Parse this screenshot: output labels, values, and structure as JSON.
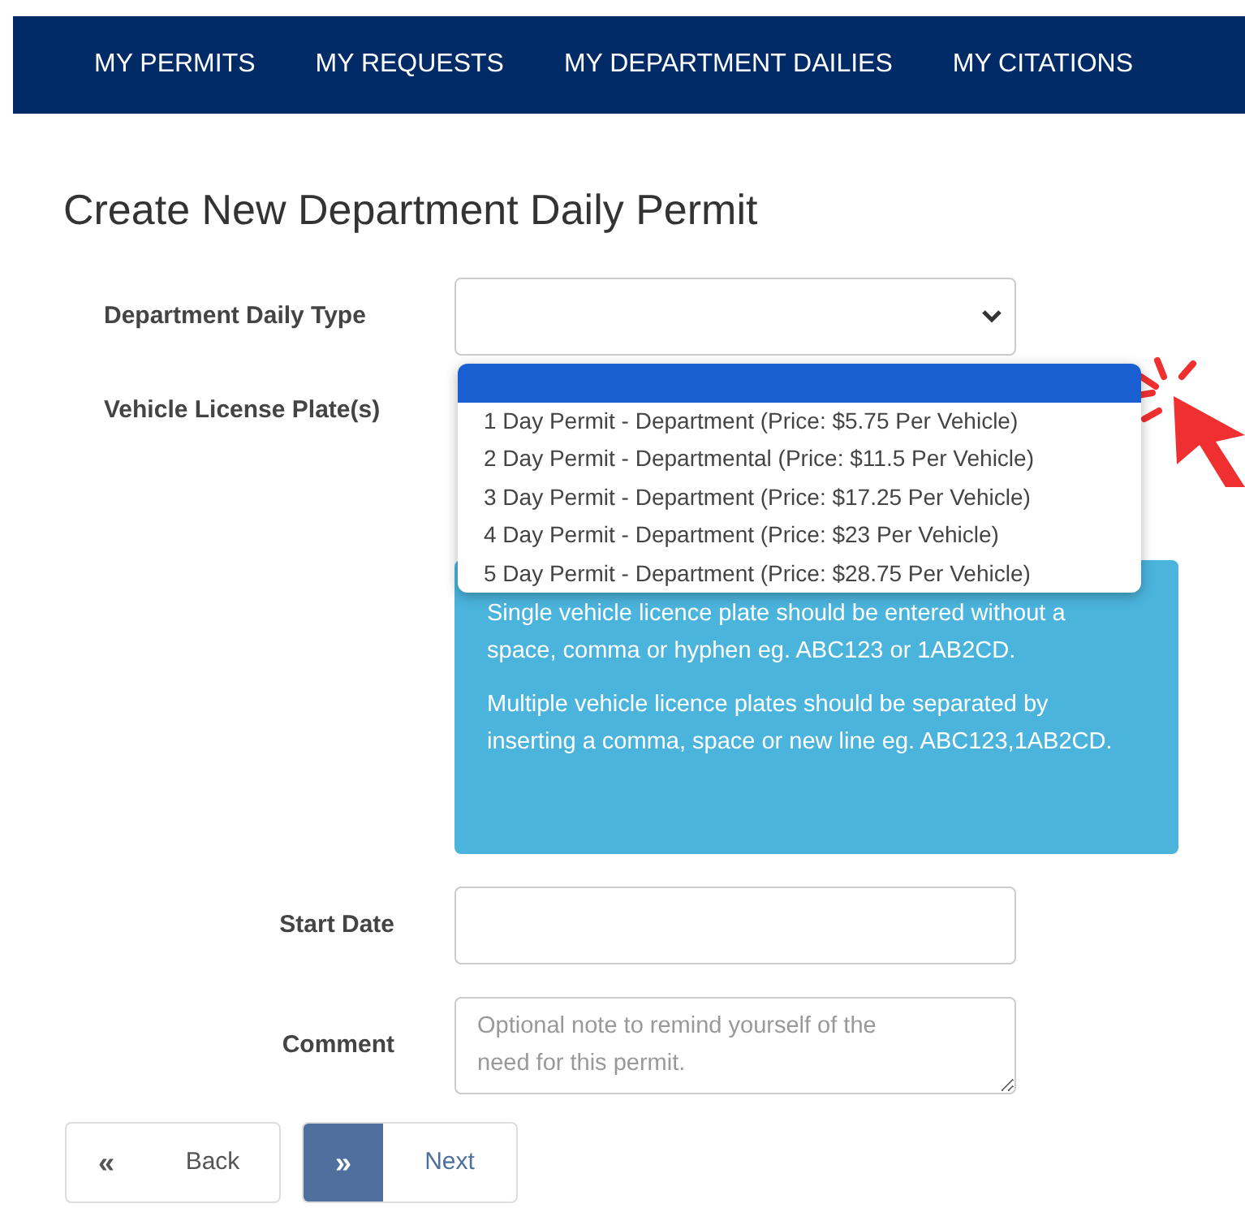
{
  "nav": [
    {
      "label": "MY PERMITS"
    },
    {
      "label": "MY REQUESTS"
    },
    {
      "label": "MY DEPARTMENT DAILIES"
    },
    {
      "label": "MY CITATIONS"
    }
  ],
  "title": "Create New Department Daily Permit",
  "type_field": {
    "label": "Department Daily Type",
    "expanded": true,
    "options": [
      {
        "selected": true
      },
      {
        "label": "1 Day Permit - Department (Price: $5.75 Per Vehicle)",
        "selected": false
      },
      {
        "label": "2 Day Permit - Departmental (Price: $11.5 Per Vehicle)",
        "selected": false
      },
      {
        "label": "3 Day Permit - Department (Price: $17.25 Per Vehicle)",
        "selected": false
      },
      {
        "label": "4 Day Permit - Department (Price: $23 Per Vehicle)",
        "selected": false
      },
      {
        "label": "5 Day Permit - Department (Price: $28.75 Per Vehicle)",
        "selected": false
      }
    ]
  },
  "plates_field": {
    "label": "Vehicle License Plate(s)"
  },
  "info": [
    "Single vehicle licence plate should be entered without a space, comma or hyphen eg. ABC123 or 1AB2CD.",
    "Multiple vehicle licence plates should be separated by inserting a comma, space or new line eg. ABC123,1AB2CD."
  ],
  "start_date": {
    "label": "Start Date"
  },
  "comment": {
    "label": "Comment",
    "placeholder": "Optional note to remind yourself of the need for this permit."
  },
  "buttons": [
    {
      "icon": "«",
      "label": "Back",
      "kind": "back"
    },
    {
      "icon": "»",
      "label": "Next",
      "kind": "next"
    }
  ]
}
